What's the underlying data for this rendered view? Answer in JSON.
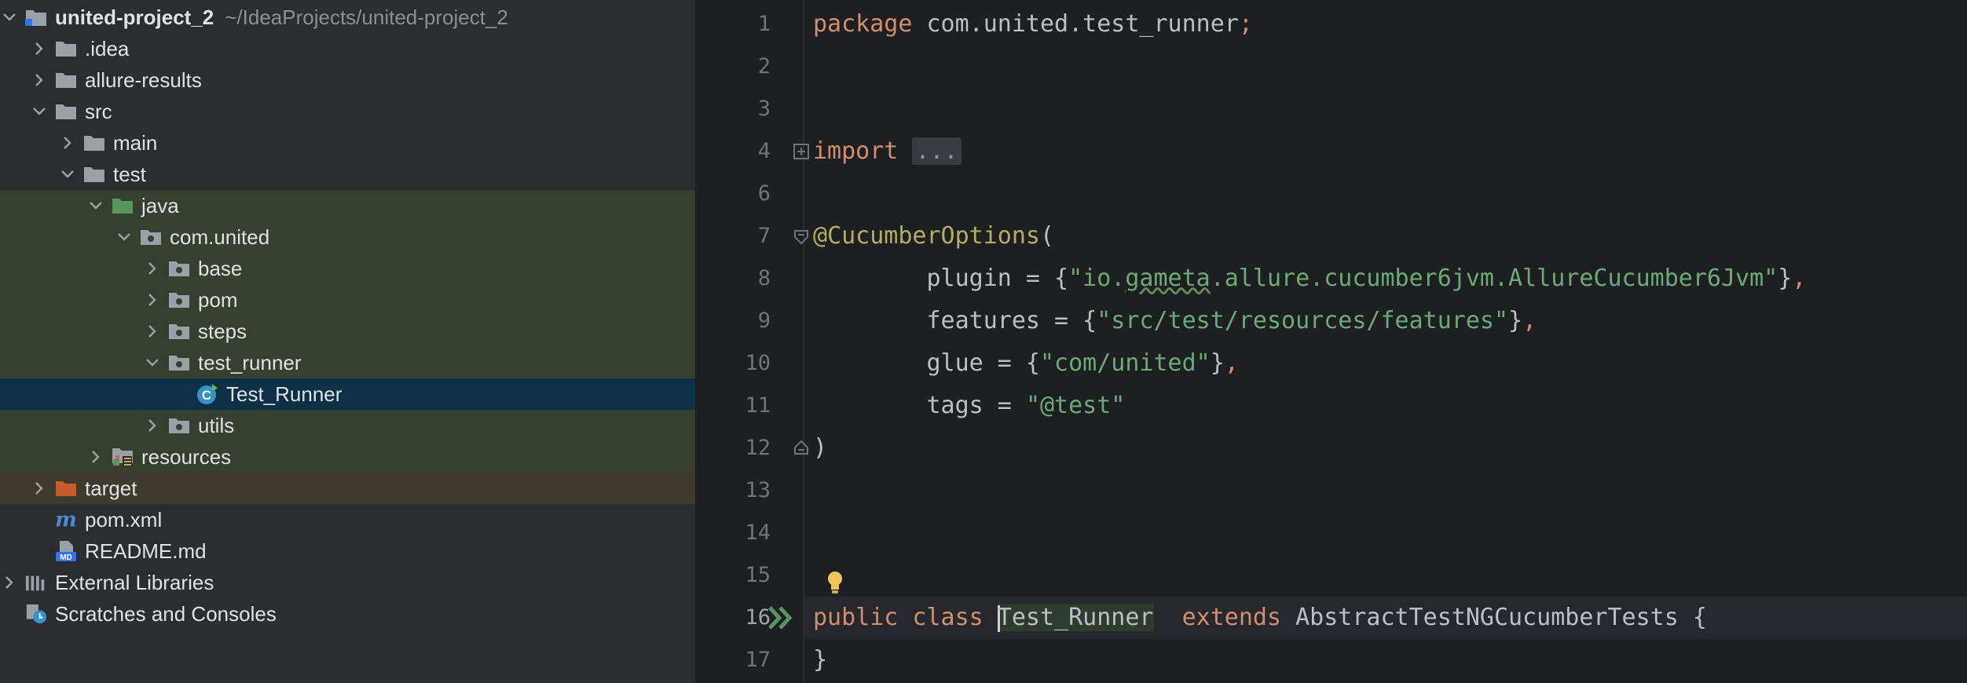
{
  "project_tree": {
    "root": {
      "label": "united-project_2",
      "path": "~/IdeaProjects/united-project_2"
    },
    "items": [
      {
        "label": ".idea"
      },
      {
        "label": "allure-results"
      },
      {
        "label": "src"
      },
      {
        "label": "main"
      },
      {
        "label": "test"
      },
      {
        "label": "java"
      },
      {
        "label": "com.united"
      },
      {
        "label": "base"
      },
      {
        "label": "pom"
      },
      {
        "label": "steps"
      },
      {
        "label": "test_runner"
      },
      {
        "label": "Test_Runner"
      },
      {
        "label": "utils"
      },
      {
        "label": "resources"
      },
      {
        "label": "target"
      },
      {
        "label": "pom.xml"
      },
      {
        "label": "README.md"
      },
      {
        "label": "External Libraries"
      },
      {
        "label": "Scratches and Consoles"
      }
    ]
  },
  "editor": {
    "line_numbers": [
      "1",
      "2",
      "3",
      "4",
      "6",
      "7",
      "8",
      "9",
      "10",
      "11",
      "12",
      "13",
      "14",
      "15",
      "16",
      "17"
    ],
    "code": {
      "l1_kw": "package",
      "l1_rest": " com.united.test_runner",
      "l1_semi": ";",
      "l4_kw": "import",
      "l4_fold": "...",
      "l7_ann": "@CucumberOptions",
      "l7_rest": "(",
      "l8_a": "        plugin = {",
      "l8_str1": "\"io.",
      "l8_str2": "gameta",
      "l8_str3": ".allure.cucumber6jvm.AllureCucumber6Jvm\"",
      "l8_b": "}",
      "l8_c": ",",
      "l9_a": "        features = {",
      "l9_str": "\"src/test/resources/features\"",
      "l9_b": "}",
      "l9_c": ",",
      "l10_a": "        glue = {",
      "l10_str": "\"com/united\"",
      "l10_b": "}",
      "l10_c": ",",
      "l11_a": "        tags = ",
      "l11_str": "\"@test\"",
      "l12": ")",
      "l16_kw1": "public",
      "l16_kw2": "class",
      "l16_cls": "Test_Runner",
      "l16_kw3": "extends",
      "l16_rest": " AbstractTestNGCucumberTests {",
      "l17": "}"
    }
  },
  "colors": {
    "tree_bg": "#2b2d30",
    "editor_bg": "#1e1f22",
    "selection": "#0d3047",
    "test_sources_bg": "#37402f",
    "excluded_bg": "#3f3a2c",
    "keyword": "#cf8e6d",
    "string": "#6aab73",
    "annotation": "#b3ae60"
  }
}
